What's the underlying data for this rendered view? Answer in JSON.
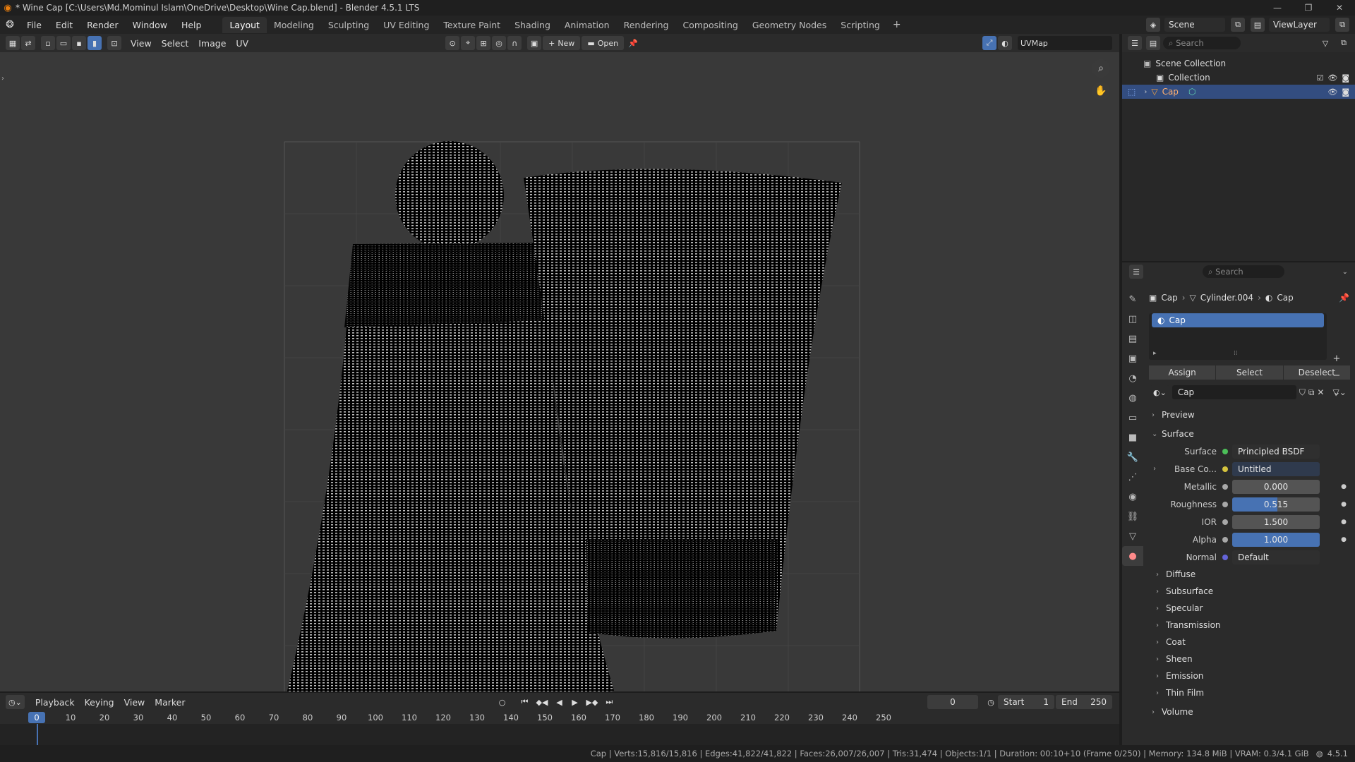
{
  "window": {
    "title": "* Wine Cap [C:\\Users\\Md.Mominul Islam\\OneDrive\\Desktop\\Wine Cap.blend] - Blender 4.5.1 LTS",
    "controls": [
      "—",
      "❐",
      "✕"
    ]
  },
  "menu": {
    "items": [
      "File",
      "Edit",
      "Render",
      "Window",
      "Help"
    ],
    "workspaces": [
      "Layout",
      "Modeling",
      "Sculpting",
      "UV Editing",
      "Texture Paint",
      "Shading",
      "Animation",
      "Rendering",
      "Compositing",
      "Geometry Nodes",
      "Scripting"
    ],
    "active_workspace": "Layout",
    "add": "+"
  },
  "scene": {
    "name": "Scene",
    "view_layer": "ViewLayer"
  },
  "uv_editor": {
    "menus": [
      "View",
      "Select",
      "Image",
      "UV"
    ],
    "new_label": "New",
    "open_label": "Open",
    "uvmap": "UVMap"
  },
  "outliner": {
    "search_placeholder": "Search",
    "rows": [
      {
        "label": "Scene Collection"
      },
      {
        "label": "Collection"
      },
      {
        "label": "Cap"
      }
    ]
  },
  "properties": {
    "search_placeholder": "Search",
    "breadcrumb": [
      "Cap",
      "Cylinder.004",
      "Cap"
    ],
    "slot": "Cap",
    "buttons": [
      "Assign",
      "Select",
      "Deselect"
    ],
    "material_name": "Cap",
    "panels": {
      "preview": "Preview",
      "surface": "Surface"
    },
    "fields": [
      {
        "label": "Surface",
        "value": "Principled BSDF",
        "dot": "#4cbf59",
        "style": "left"
      },
      {
        "label": "Base Co...",
        "value": "Untitled",
        "dot": "#d6c43e",
        "style": "left-blue"
      },
      {
        "label": "Metallic",
        "value": "0.000",
        "dot": "#a8a8a8",
        "style": "num"
      },
      {
        "label": "Roughness",
        "value": "0.515",
        "dot": "#a8a8a8",
        "style": "prog",
        "fill": 0.515
      },
      {
        "label": "IOR",
        "value": "1.500",
        "dot": "#a8a8a8",
        "style": "num"
      },
      {
        "label": "Alpha",
        "value": "1.000",
        "dot": "#a8a8a8",
        "style": "full"
      },
      {
        "label": "Normal",
        "value": "Default",
        "dot": "#6464d8",
        "style": "left"
      }
    ],
    "subpanels": [
      "Diffuse",
      "Subsurface",
      "Specular",
      "Transmission",
      "Coat",
      "Sheen",
      "Emission",
      "Thin Film"
    ],
    "volume": "Volume"
  },
  "timeline": {
    "menus": [
      "Playback",
      "Keying",
      "View",
      "Marker"
    ],
    "current_frame": "0",
    "start_label": "Start",
    "start": "1",
    "end_label": "End",
    "end": "250",
    "ticks": [
      "10",
      "20",
      "30",
      "40",
      "50",
      "60",
      "70",
      "80",
      "90",
      "100",
      "110",
      "120",
      "130",
      "140",
      "150",
      "160",
      "170",
      "180",
      "190",
      "200",
      "210",
      "220",
      "230",
      "240",
      "250"
    ],
    "playhead": "0"
  },
  "status": {
    "text": "Cap | Verts:15,816/15,816 | Edges:41,822/41,822 | Faces:26,007/26,007 | Tris:31,474 | Objects:1/1 | Duration: 00:10+10 (Frame 0/250) | Memory: 134.8 MiB | VRAM: 0.3/4.1 GiB",
    "version": "4.5.1"
  },
  "colors": {
    "accent": "#4772b3",
    "selection": "#334d80",
    "viewport_bg": "#393939",
    "uv_wire": "#000000"
  }
}
